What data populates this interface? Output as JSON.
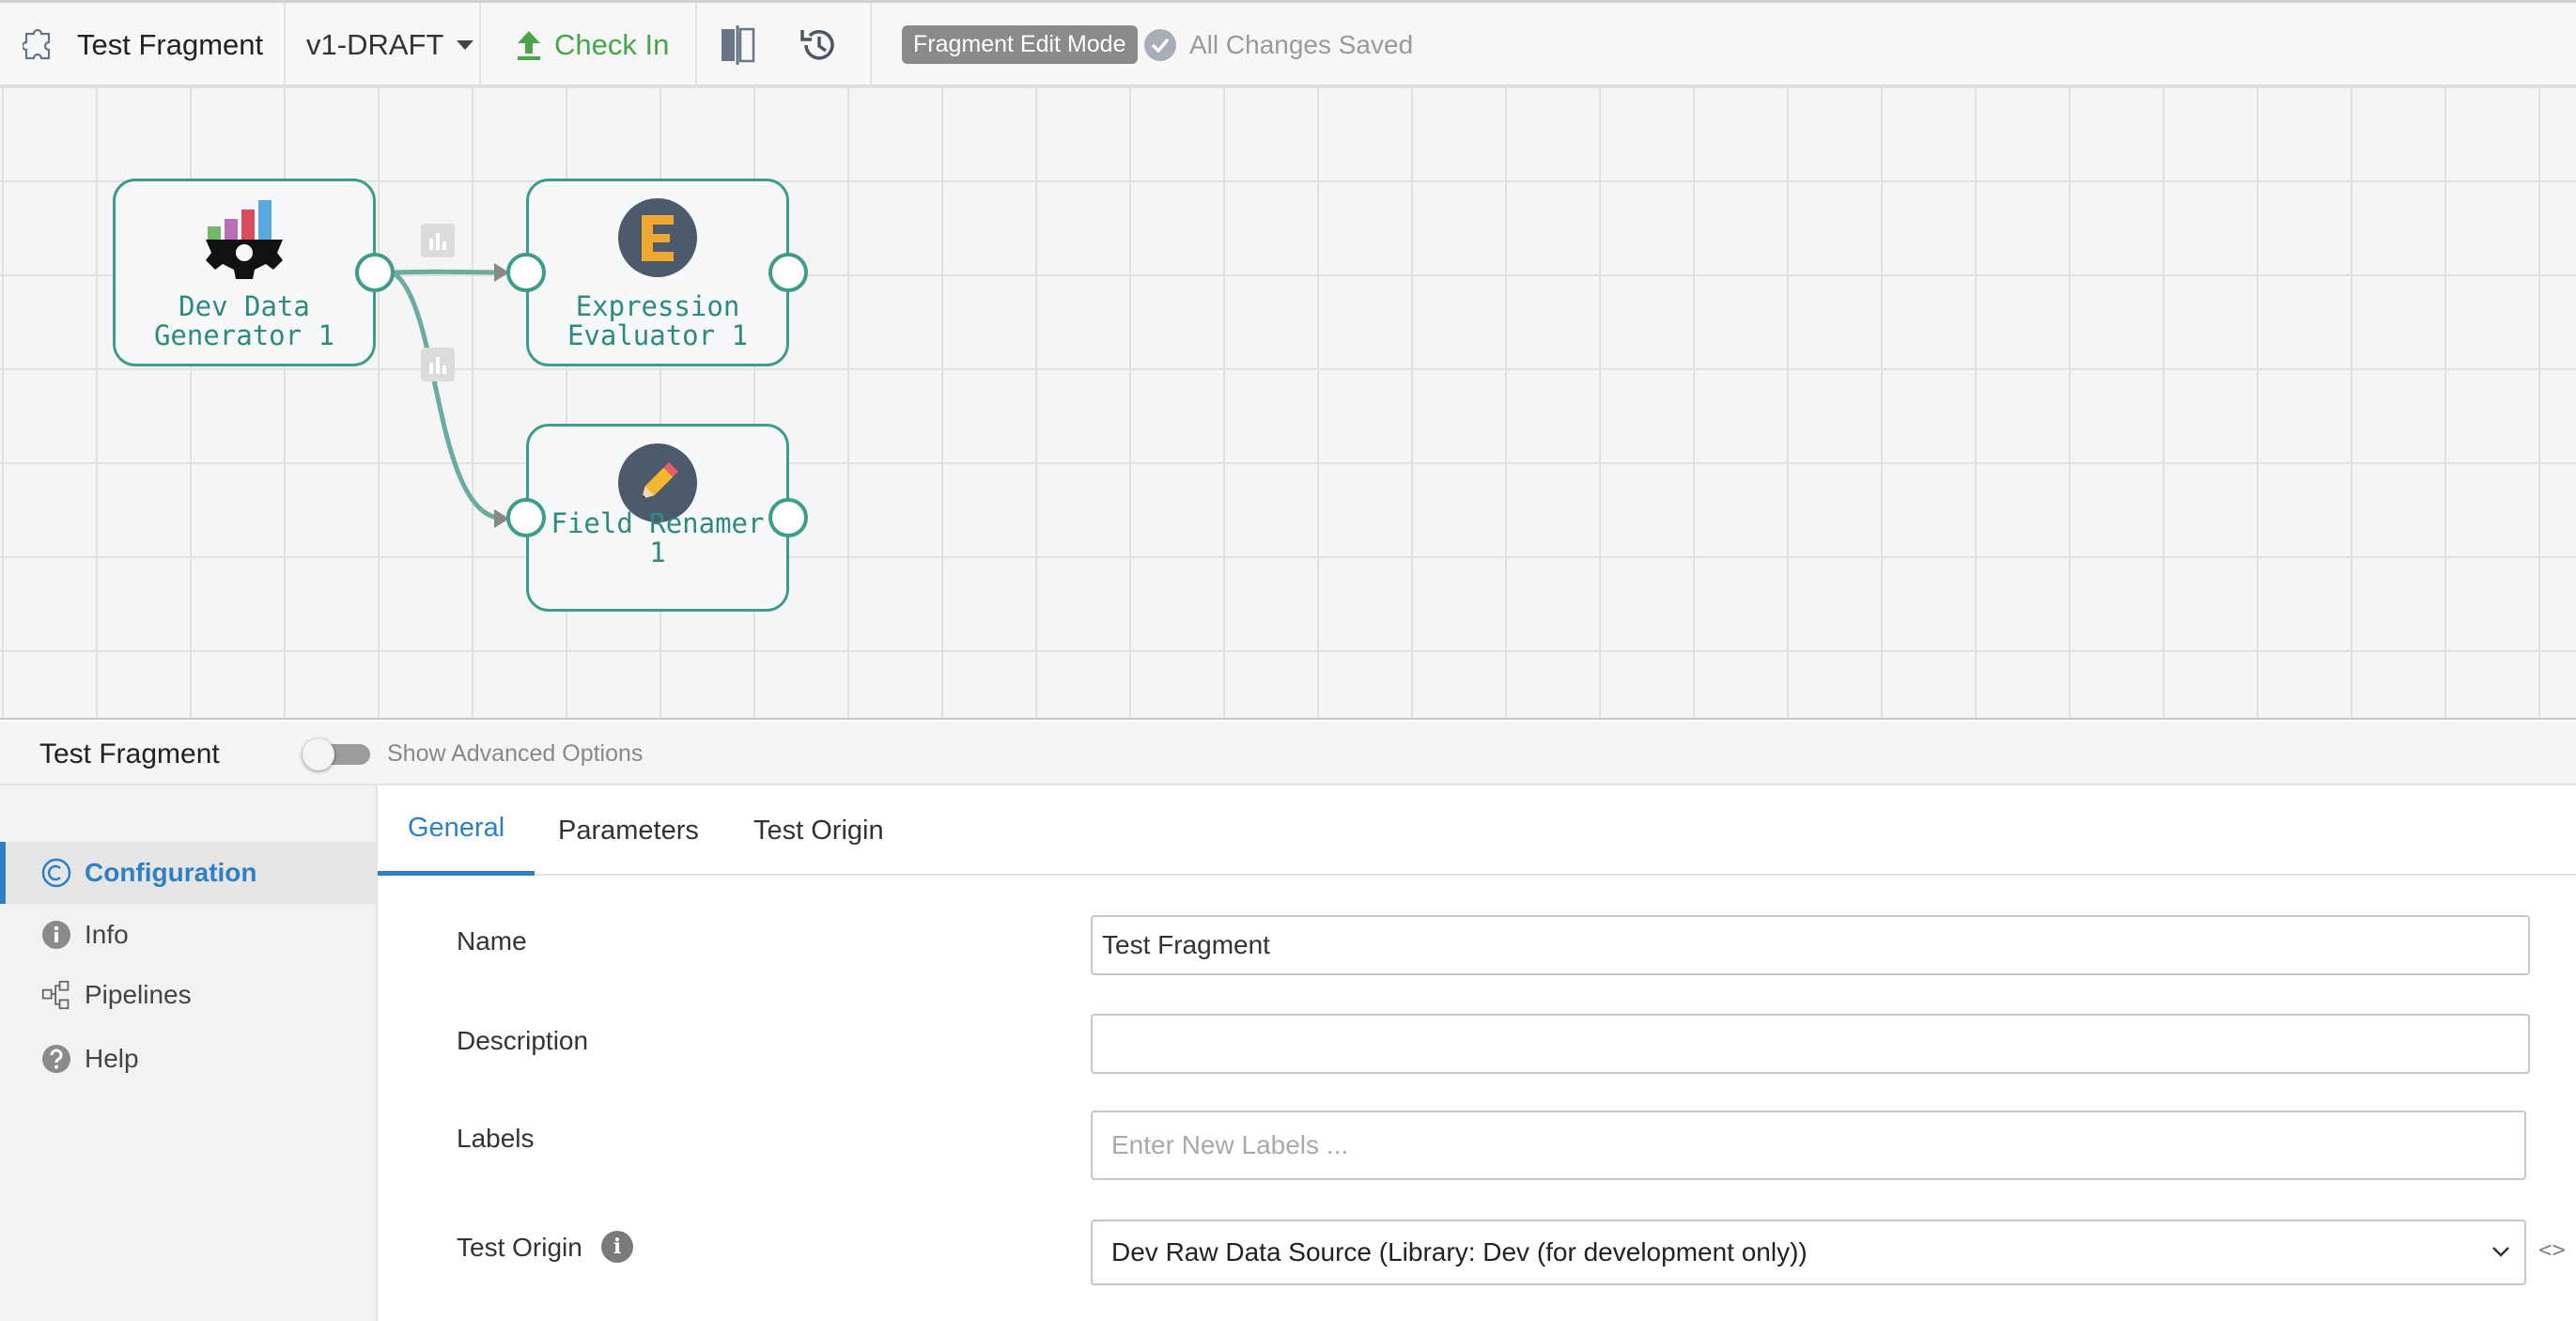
{
  "toolbar": {
    "title": "Test Fragment",
    "version": "v1-DRAFT",
    "check_in": "Check In",
    "mode_badge": "Fragment Edit Mode",
    "save_status": "All Changes Saved"
  },
  "canvas": {
    "nodes": [
      {
        "label_line1": "Dev Data",
        "label_line2": "Generator 1",
        "icon": "dev-data-generator-icon"
      },
      {
        "label_line1": "Expression",
        "label_line2": "Evaluator 1",
        "icon": "expression-evaluator-icon"
      },
      {
        "label_line1": "Field Renamer 1",
        "icon": "field-renamer-icon"
      }
    ]
  },
  "panel": {
    "title": "Test Fragment",
    "advanced_toggle_label": "Show Advanced Options"
  },
  "sidebar": {
    "items": [
      {
        "label": "Configuration",
        "icon": "configuration-icon"
      },
      {
        "label": "Info",
        "icon": "info-icon"
      },
      {
        "label": "Pipelines",
        "icon": "pipelines-icon"
      },
      {
        "label": "Help",
        "icon": "help-icon"
      }
    ]
  },
  "tabs": [
    "General",
    "Parameters",
    "Test Origin"
  ],
  "form": {
    "name_label": "Name",
    "name_value": "Test Fragment",
    "description_label": "Description",
    "description_value": "",
    "labels_label": "Labels",
    "labels_placeholder": "Enter New Labels ...",
    "test_origin_label": "Test Origin",
    "test_origin_value": "Dev Raw Data Source (Library: Dev (for development only))",
    "code_toggle": "<>"
  },
  "colors": {
    "accent": "#2f7fc7",
    "node_border": "#3e9c8b",
    "check_in": "#48a548"
  }
}
